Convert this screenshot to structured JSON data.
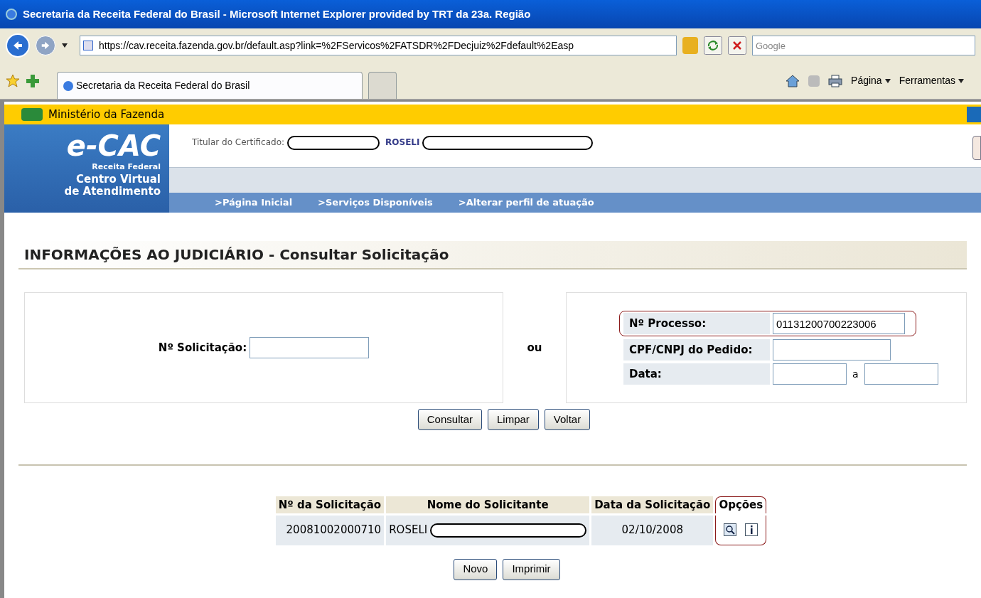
{
  "window": {
    "title": "Secretaria da Receita Federal do Brasil - Microsoft Internet Explorer provided by TRT da 23a. Região"
  },
  "browser": {
    "url": "https://cav.receita.fazenda.gov.br/default.asp?link=%2FServicos%2FATSDR%2FDecjuiz%2Fdefault%2Easp",
    "search_placeholder": "Google",
    "tabs": [
      {
        "label": "Secretaria da Receita Federal do Brasil",
        "selected": true
      },
      {
        "selected": false
      }
    ],
    "commands": [
      "Página",
      "Ferramentas"
    ]
  },
  "ministry": "Ministério da Fazenda",
  "logo": {
    "brand": "e-CAC",
    "sub": "Receita Federal",
    "line1": "Centro Virtual",
    "line2": "de Atendimento"
  },
  "certificate": {
    "label": "Titular do Certificado:",
    "name": "ROSELI"
  },
  "nav": [
    ">Página Inicial",
    ">Serviços Disponíveis",
    ">Alterar perfil de atuação"
  ],
  "page_title": "INFORMAÇÕES AO JUDICIÁRIO - Consultar Solicitação",
  "form": {
    "solicitacao_label": "Nº Solicitação:",
    "or": "ou",
    "processo_label": "Nº Processo:",
    "processo_value": "01131200700223006",
    "cpf_label": "CPF/CNPJ do Pedido:",
    "data_label": "Data:",
    "data_sep": "a"
  },
  "buttons": [
    "Consultar",
    "Limpar",
    "Voltar"
  ],
  "table": {
    "columns": [
      "Nº da Solicitação",
      "Nome do Solicitante",
      "Data da Solicitação",
      "Opções"
    ],
    "rows": [
      {
        "number": "20081002000710",
        "name": "ROSELI",
        "date": "02/10/2008"
      }
    ]
  },
  "bottom_buttons": [
    "Novo",
    "Imprimir"
  ]
}
